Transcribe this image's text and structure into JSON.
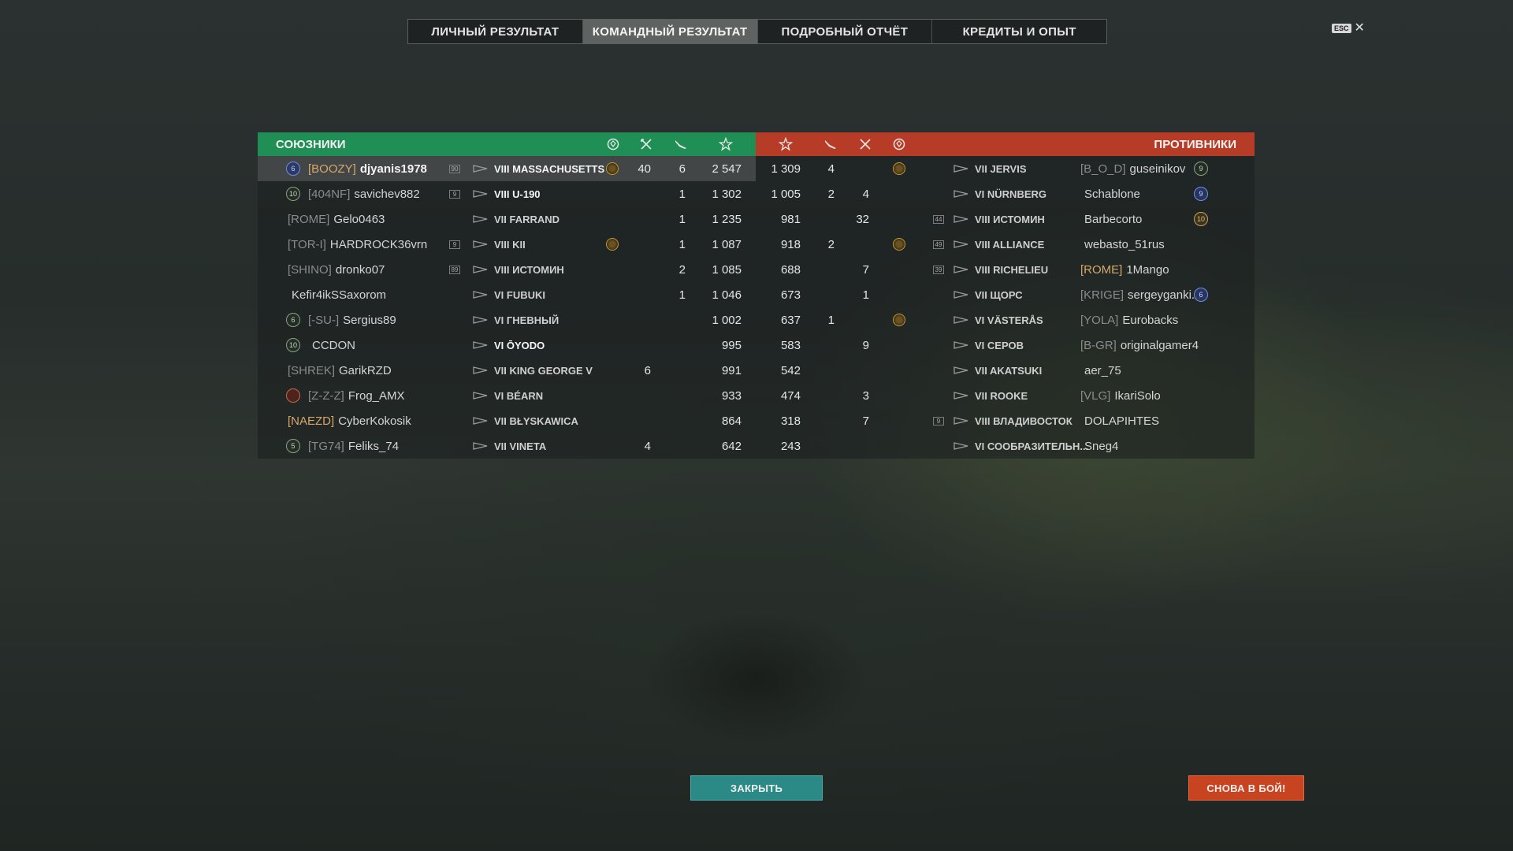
{
  "tabs": [
    {
      "label": "ЛИЧНЫЙ РЕЗУЛЬТАТ",
      "active": false
    },
    {
      "label": "КОМАНДНЫЙ РЕЗУЛЬТАТ",
      "active": true
    },
    {
      "label": "ПОДРОБНЫЙ ОТЧЁТ",
      "active": false
    },
    {
      "label": "КРЕДИТЫ И ОПЫТ",
      "active": false
    }
  ],
  "esc": {
    "key": "ESC",
    "close_symbol": "✕"
  },
  "allies": {
    "label": "СОЮЗНИКИ",
    "color": "#1f8f55",
    "rows": [
      {
        "rank": "6",
        "rank_style": "blue",
        "clan": "[BOOZY]",
        "clan_gold": true,
        "player": "djyanis1978",
        "bright": true,
        "division": "90",
        "ship": "VIII MASSACHUSETTS",
        "ship_bright": true,
        "medal": true,
        "kills": "40",
        "planes": "6",
        "xp": "2 547",
        "highlight": true
      },
      {
        "rank": "10",
        "rank_style": "green",
        "clan": "[404NF]",
        "player": "savichev882",
        "division": "9",
        "ship": "VIII U-190",
        "ship_bright": true,
        "medal": false,
        "kills": "",
        "planes": "1",
        "xp": "1 302"
      },
      {
        "rank": "",
        "clan": "[ROME]",
        "player": "Gelo0463",
        "division": "",
        "ship": "VII FARRAND",
        "medal": false,
        "kills": "",
        "planes": "1",
        "xp": "1 235"
      },
      {
        "rank": "",
        "clan": "[TOR-I]",
        "player": "HARDROCK36vrn",
        "division": "9",
        "ship": "VIII KII",
        "medal": true,
        "kills": "",
        "planes": "1",
        "xp": "1 087"
      },
      {
        "rank": "",
        "clan": "[SHINO]",
        "player": "dronko07",
        "division": "89",
        "ship": "VIII ИСТОМИН",
        "medal": false,
        "kills": "",
        "planes": "2",
        "xp": "1 085"
      },
      {
        "rank": "",
        "clan": "",
        "player": "Kefir4ikSSaxorom",
        "division": "",
        "ship": "VI FUBUKI",
        "medal": false,
        "kills": "",
        "planes": "1",
        "xp": "1 046"
      },
      {
        "rank": "6",
        "rank_style": "green",
        "clan": "[-SU-]",
        "player": "Sergius89",
        "division": "",
        "ship": "VI ГНЕВНЫЙ",
        "medal": false,
        "kills": "",
        "planes": "",
        "xp": "1 002"
      },
      {
        "rank": "10",
        "rank_style": "green",
        "clan": "",
        "player": "CCDON",
        "bright": false,
        "division": "",
        "ship": "VI ŌYODO",
        "ship_bright": true,
        "medal": false,
        "kills": "",
        "planes": "",
        "xp": "995"
      },
      {
        "rank": "",
        "clan": "[SHREK]",
        "player": "GarikRZD",
        "division": "",
        "ship": "VII KING GEORGE V",
        "medal": false,
        "kills": "6",
        "planes": "",
        "xp": "991"
      },
      {
        "rank": "",
        "rank_style": "red",
        "rank_icon": true,
        "clan": "[Z-Z-Z]",
        "player": "Frog_AMX",
        "division": "",
        "ship": "VI BÉARN",
        "medal": false,
        "kills": "",
        "planes": "",
        "xp": "933"
      },
      {
        "rank": "",
        "clan": "[NAEZD]",
        "clan_gold": true,
        "player": "CyberKokosik",
        "division": "",
        "ship": "VII BŁYSKAWICA",
        "medal": false,
        "kills": "",
        "planes": "",
        "xp": "864"
      },
      {
        "rank": "5",
        "rank_style": "green",
        "clan": "[TG74]",
        "player": "Feliks_74",
        "division": "",
        "ship": "VII VINETA",
        "medal": false,
        "kills": "4",
        "planes": "",
        "xp": "642"
      }
    ]
  },
  "enemies": {
    "label": "ПРОТИВНИКИ",
    "color": "#b73c27",
    "rows": [
      {
        "xp": "1 309",
        "planes": "4",
        "kills": "",
        "medal": true,
        "division": "",
        "ship": "VII JERVIS",
        "clan": "[B_O_D]",
        "player": "guseinikov",
        "rank": "9",
        "rank_style": "green"
      },
      {
        "xp": "1 005",
        "planes": "2",
        "kills": "4",
        "medal": false,
        "division": "",
        "ship": "VI NÜRNBERG",
        "clan": "",
        "player": "Schablone",
        "rank": "9",
        "rank_style": "blue"
      },
      {
        "xp": "981",
        "planes": "",
        "kills": "32",
        "medal": false,
        "division": "44",
        "ship": "VIII ИСТОМИН",
        "clan": "",
        "player": "Barbecorto",
        "rank": "10",
        "rank_style": "gold"
      },
      {
        "xp": "918",
        "planes": "2",
        "kills": "",
        "medal": true,
        "division": "49",
        "ship": "VIII ALLIANCE",
        "clan": "",
        "player": "webasto_51rus",
        "rank": ""
      },
      {
        "xp": "688",
        "planes": "",
        "kills": "7",
        "medal": false,
        "division": "39",
        "ship": "VIII RICHELIEU",
        "clan": "[ROME]",
        "clan_gold": true,
        "player": "1Mango",
        "rank": ""
      },
      {
        "xp": "673",
        "planes": "",
        "kills": "1",
        "medal": false,
        "division": "",
        "ship": "VII ЩОРС",
        "clan": "[KRIGE]",
        "player": "sergeyganki...",
        "rank": "6",
        "rank_style": "blue"
      },
      {
        "xp": "637",
        "planes": "1",
        "kills": "",
        "medal": true,
        "division": "",
        "ship": "VI VÄSTERÅS",
        "clan": "[YOLA]",
        "player": "Eurobacks",
        "rank": ""
      },
      {
        "xp": "583",
        "planes": "",
        "kills": "9",
        "medal": false,
        "division": "",
        "ship": "VI СЕРОВ",
        "clan": "[B-GR]",
        "player": "originalgamer4",
        "rank": ""
      },
      {
        "xp": "542",
        "planes": "",
        "kills": "",
        "medal": false,
        "division": "",
        "ship": "VII AKATSUKI",
        "clan": "",
        "player": "aer_75",
        "rank": ""
      },
      {
        "xp": "474",
        "planes": "",
        "kills": "3",
        "medal": false,
        "division": "",
        "ship": "VII ROOKE",
        "clan": "[VLG]",
        "player": "IkariSolo",
        "rank": ""
      },
      {
        "xp": "318",
        "planes": "",
        "kills": "7",
        "medal": false,
        "division": "9",
        "ship": "VIII ВЛАДИВОСТОК",
        "clan": "",
        "player": "DOLAPIHTES",
        "rank": ""
      },
      {
        "xp": "243",
        "planes": "",
        "kills": "",
        "medal": false,
        "division": "",
        "ship": "VI СООБРАЗИТЕЛЬН...",
        "clan": "",
        "player": "Sneg4",
        "rank": ""
      }
    ]
  },
  "buttons": {
    "close": "ЗАКРЫТЬ",
    "battle": "СНОВА В БОЙ!"
  }
}
